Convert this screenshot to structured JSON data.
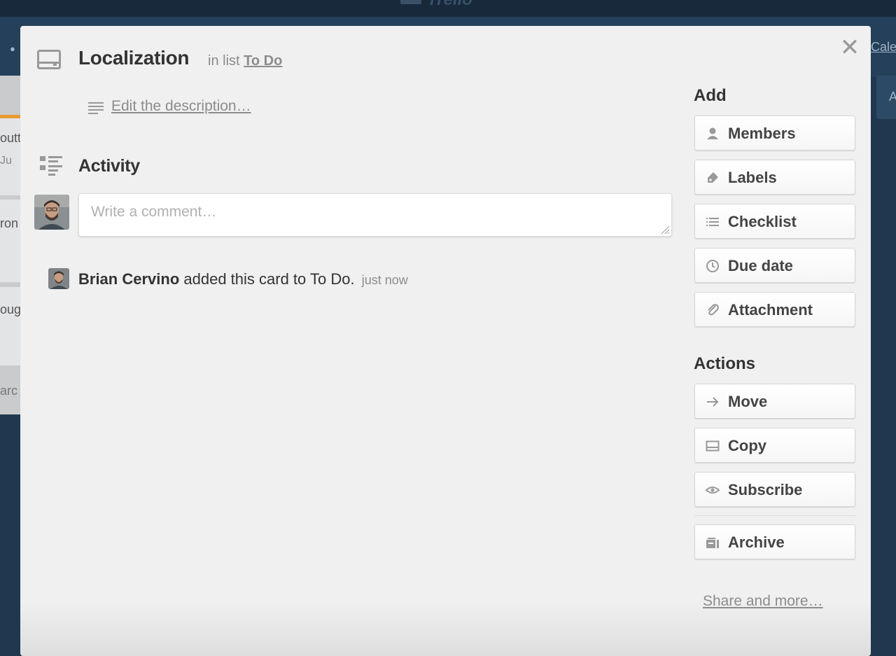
{
  "background": {
    "logo_text": "Trello",
    "header_link": "Cale",
    "card_texts": [
      "outt",
      "Ju",
      "ron",
      "oug"
    ],
    "add_card_text": "arc",
    "right_list_initial": "A"
  },
  "card": {
    "title": "Localization",
    "in_list_prefix": "in list",
    "list_name": "To Do",
    "description_link": "Edit the description…"
  },
  "activity": {
    "heading": "Activity",
    "comment_placeholder": "Write a comment…",
    "comment_value": "",
    "entries": [
      {
        "user": "Brian Cervino",
        "text": "added this card to To Do.",
        "time": "just now"
      }
    ]
  },
  "sidebar": {
    "add_heading": "Add",
    "add_buttons": [
      {
        "label": "Members",
        "icon": "person-icon"
      },
      {
        "label": "Labels",
        "icon": "tag-icon"
      },
      {
        "label": "Checklist",
        "icon": "checklist-icon"
      },
      {
        "label": "Due date",
        "icon": "clock-icon"
      },
      {
        "label": "Attachment",
        "icon": "paperclip-icon"
      }
    ],
    "actions_heading": "Actions",
    "action_buttons": [
      {
        "label": "Move",
        "icon": "arrow-right-icon"
      },
      {
        "label": "Copy",
        "icon": "card-icon"
      },
      {
        "label": "Subscribe",
        "icon": "eye-icon"
      },
      {
        "label": "Archive",
        "icon": "archive-icon"
      }
    ],
    "share_link": "Share and more…"
  },
  "colors": {
    "board_background": "#1f3850",
    "modal_background": "#f0f0f0",
    "card_label_accent": "#e89b33"
  }
}
